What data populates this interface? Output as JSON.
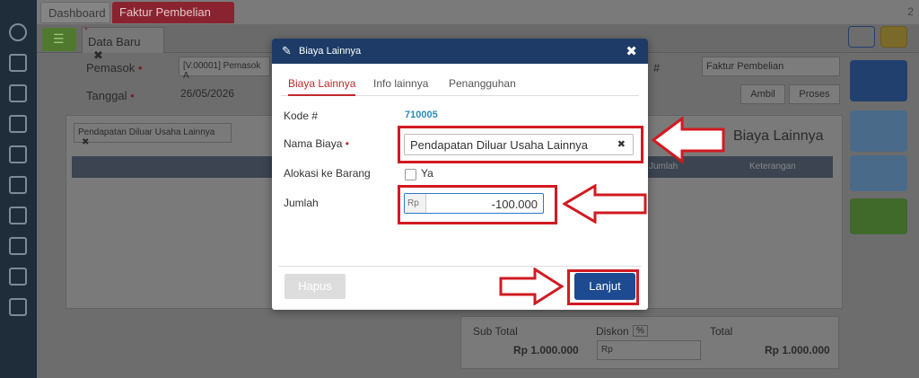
{
  "tabs": {
    "dashboard": "Dashboard",
    "faktur": "Faktur Pembelian",
    "count": "2"
  },
  "doc_tab": {
    "label": "Data Baru",
    "close": "✖"
  },
  "form": {
    "pemasok_label": "Pemasok",
    "pemasok_value": "[V.00001] Pemasok A",
    "tanggal_label": "Tanggal",
    "tanggal_value": "26/05/2026",
    "type_value": "Faktur Pembelian",
    "ambil_label": "Ambil",
    "proses_label": "Proses",
    "hash_label": "#"
  },
  "filter_chip": {
    "label": "Pendapatan Diluar Usaha Lainnya",
    "close": "✖"
  },
  "section_title": "Biaya Lainnya",
  "table_headers": {
    "jumlah": "Jumlah",
    "keterangan": "Keterangan"
  },
  "totals": {
    "subtotal_label": "Sub Total",
    "subtotal_value": "Rp 1.000.000",
    "diskon_label": "Diskon",
    "diskon_pct": "%",
    "diskon_placeholder": "Rp",
    "total_label": "Total",
    "total_value": "Rp 1.000.000"
  },
  "modal": {
    "title": "Biaya Lainnya",
    "close": "✖",
    "tabs": [
      "Biaya Lainnya",
      "Info lainnya",
      "Penangguhan"
    ],
    "kode_label": "Kode #",
    "kode_value": "710005",
    "nama_label": "Nama Biaya",
    "nama_value": "Pendapatan Diluar Usaha Lainnya",
    "nama_clear": "✖",
    "alokasi_label": "Alokasi ke Barang",
    "alokasi_option": "Ya",
    "jumlah_label": "Jumlah",
    "jumlah_prefix": "Rp",
    "jumlah_value": "-100.000",
    "hapus_label": "Hapus",
    "lanjut_label": "Lanjut"
  },
  "colors": {
    "header": "#1d3b66",
    "accent": "#c1272d",
    "primary_btn": "#1d4a90",
    "highlight": "#d11a22"
  }
}
